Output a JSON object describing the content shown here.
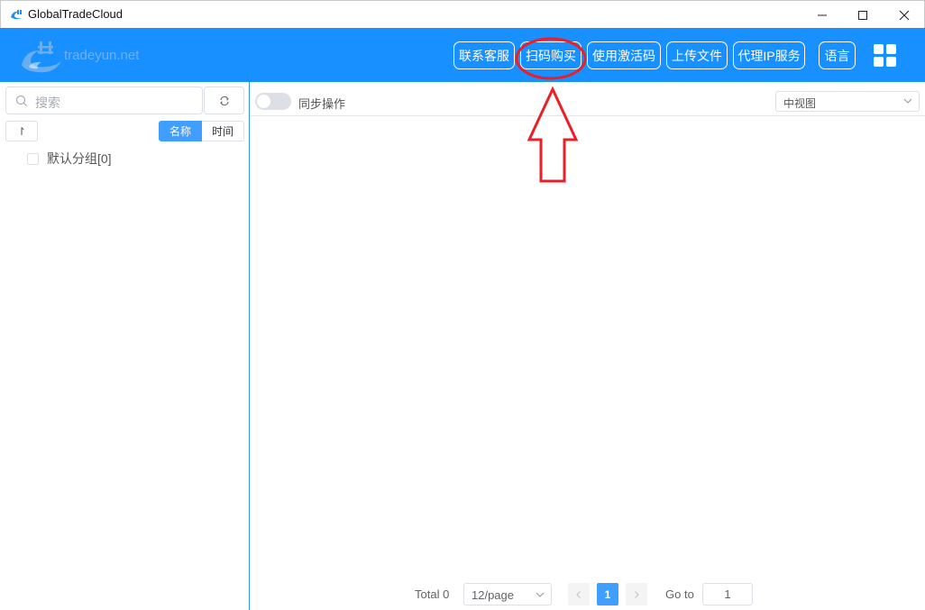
{
  "window": {
    "title": "GlobalTradeCloud"
  },
  "header": {
    "logo_text": "tradeyun.net",
    "buttons": [
      "联系客服",
      "扫码购买",
      "使用激活码",
      "上传文件",
      "代理IP服务",
      "语言"
    ],
    "brand_color": "#1890ff"
  },
  "sidebar": {
    "search_placeholder": "搜索",
    "sort_label": "↾",
    "sort_tabs": [
      "名称",
      "时间"
    ],
    "active_sort": "名称",
    "groups": [
      {
        "label": "默认分组[0]",
        "checked": false
      }
    ]
  },
  "main": {
    "sync_label": "同步操作",
    "sync_on": false,
    "view_mode": "中视图"
  },
  "pagination": {
    "total_label": "Total 0",
    "page_size": "12/page",
    "current_page": "1",
    "goto_label": "Go to",
    "goto_value": "1"
  },
  "annotation_color": "#e8202a"
}
